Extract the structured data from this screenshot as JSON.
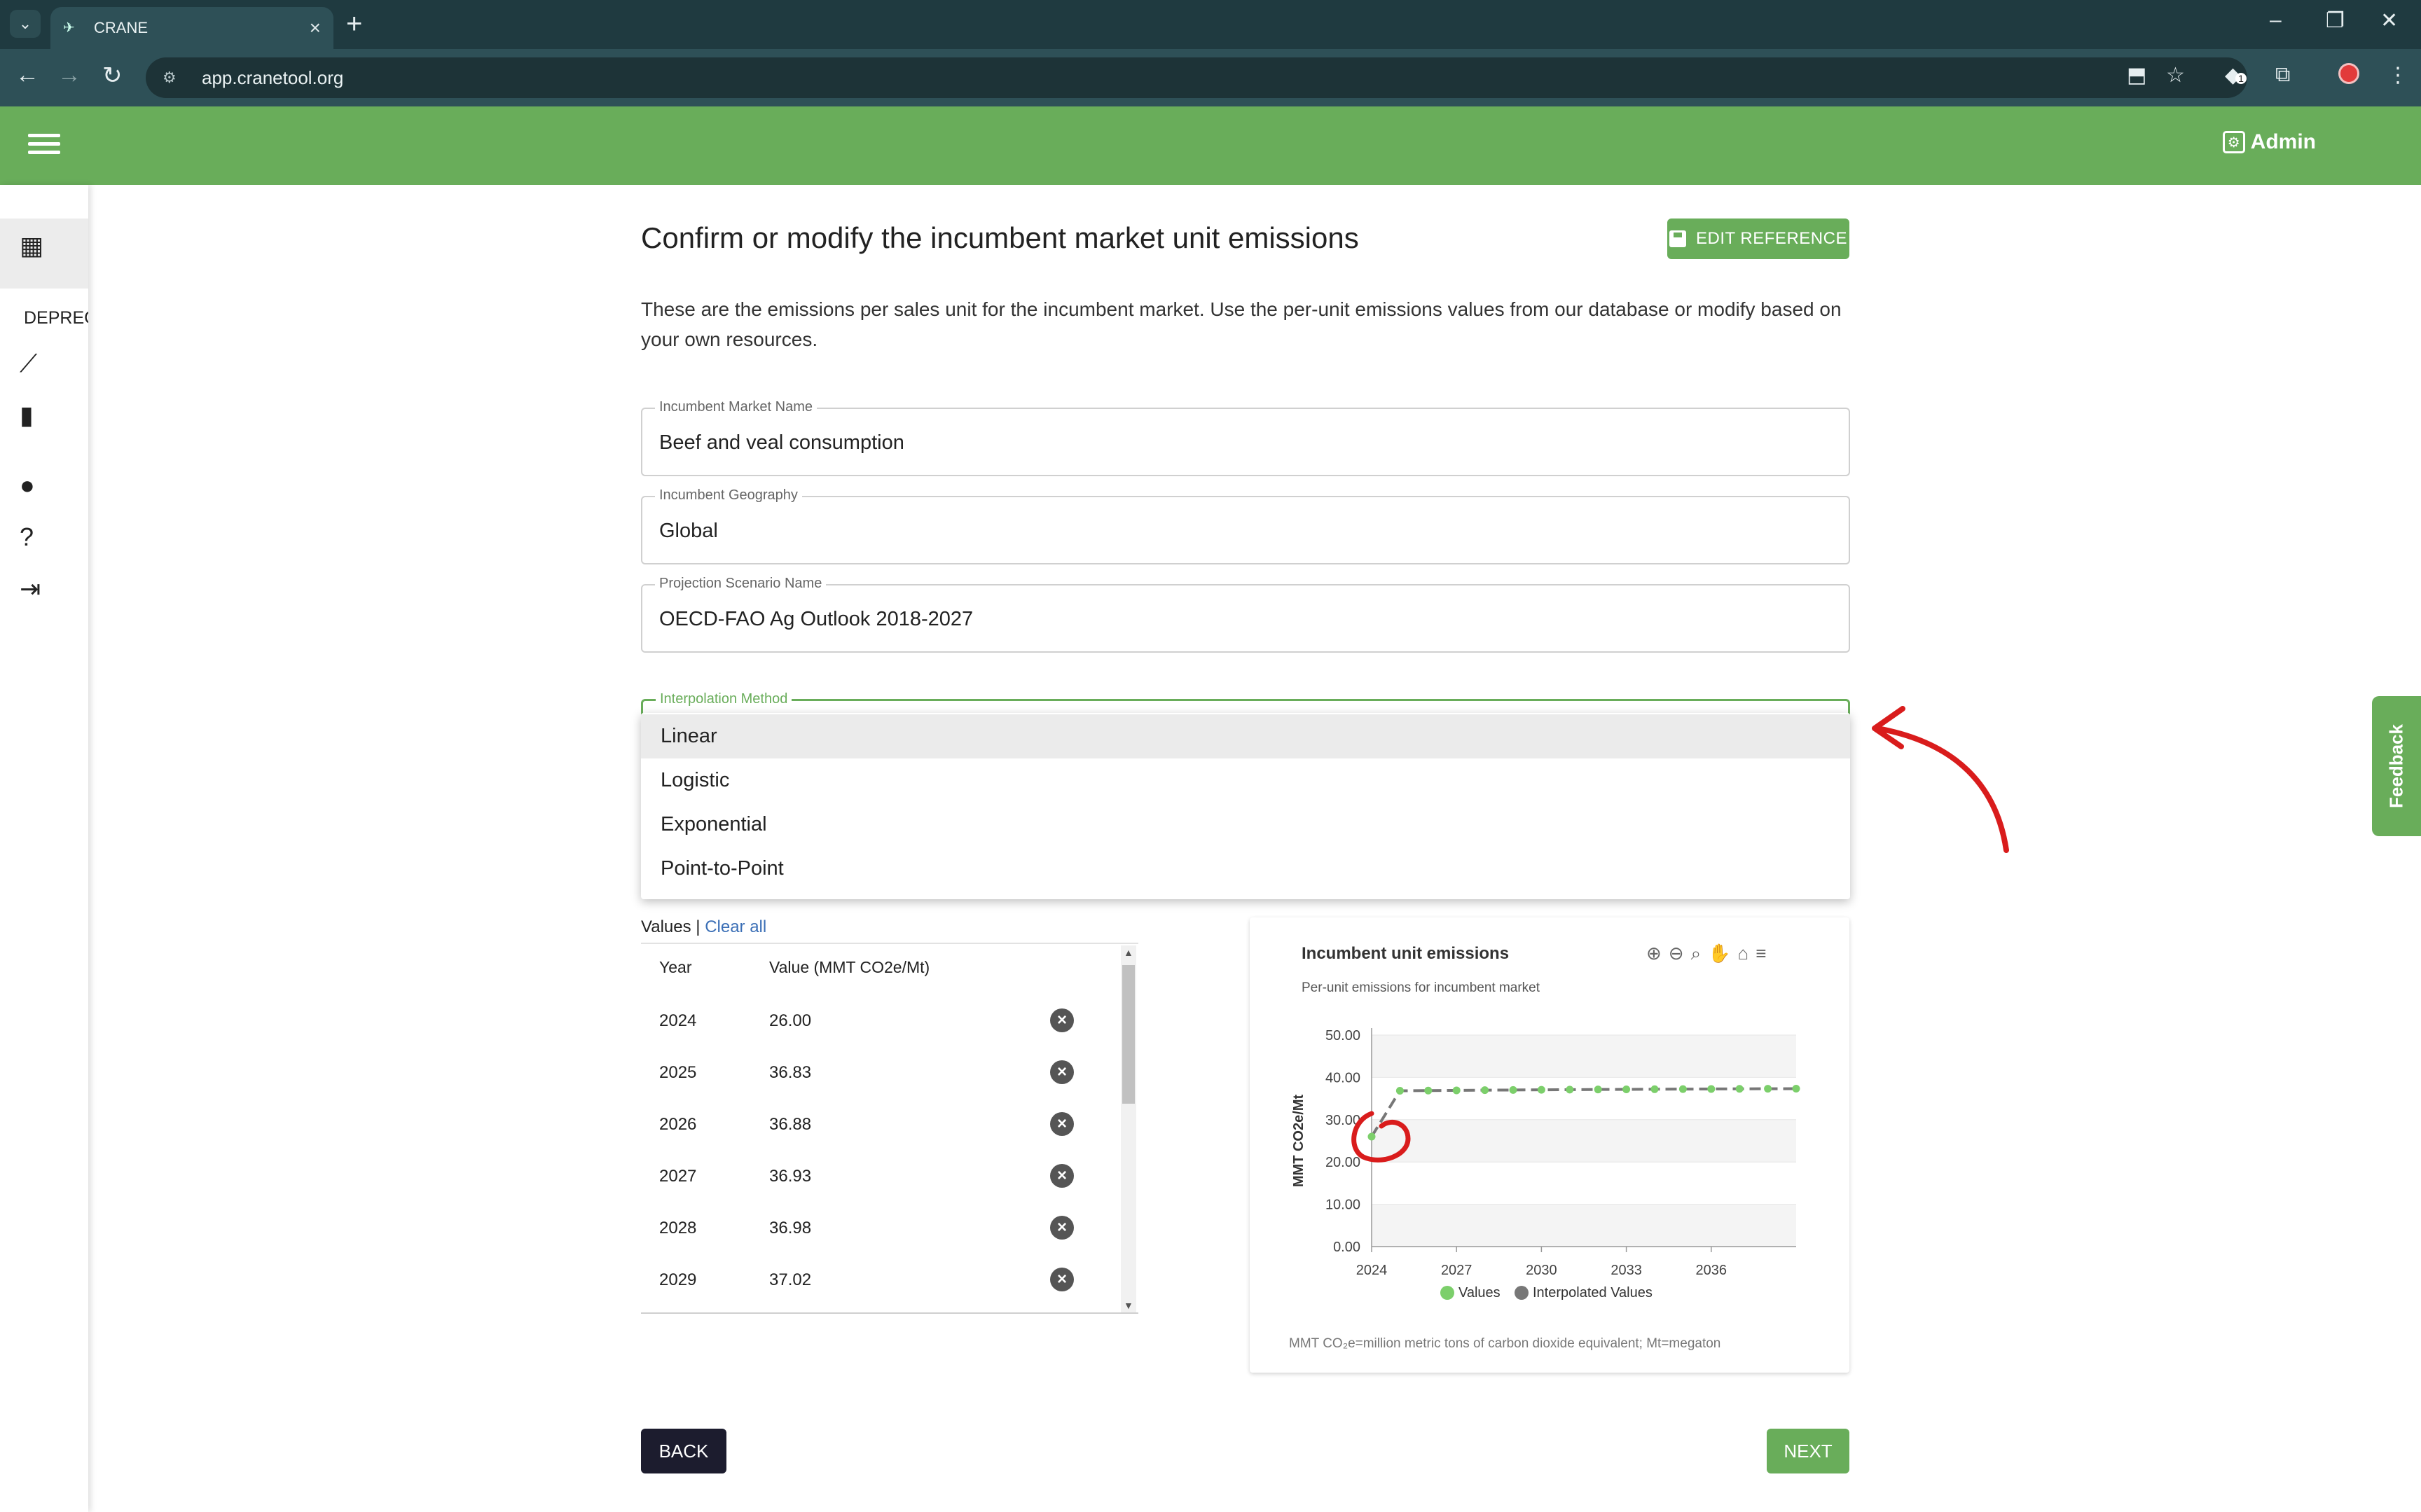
{
  "browser": {
    "tab_title": "CRANE",
    "url": "app.cranetool.org",
    "extension_badge": "1"
  },
  "header": {
    "admin_label": "Admin"
  },
  "sidebar": {
    "section_label": "DEPRECA"
  },
  "page": {
    "title": "Confirm or modify the incumbent market unit emissions",
    "edit_reference_label": "EDIT REFERENCE",
    "description": "These are the emissions per sales unit for the incumbent market. Use the per-unit emissions values from our database or modify based on your own resources."
  },
  "form": {
    "market_name": {
      "label": "Incumbent Market Name",
      "value": "Beef and veal consumption"
    },
    "geography": {
      "label": "Incumbent Geography",
      "value": "Global"
    },
    "scenario": {
      "label": "Projection Scenario Name",
      "value": "OECD-FAO Ag Outlook 2018-2027"
    },
    "interpolation": {
      "label": "Interpolation Method",
      "selected": "Linear",
      "options": [
        "Linear",
        "Logistic",
        "Exponential",
        "Point-to-Point"
      ]
    }
  },
  "values_table": {
    "heading": "Values |",
    "clear_all": "Clear all",
    "col_year": "Year",
    "col_value": "Value (MMT CO2e/Mt)",
    "rows": [
      {
        "year": "2024",
        "value": "26.00"
      },
      {
        "year": "2025",
        "value": "36.83"
      },
      {
        "year": "2026",
        "value": "36.88"
      },
      {
        "year": "2027",
        "value": "36.93"
      },
      {
        "year": "2028",
        "value": "36.98"
      },
      {
        "year": "2029",
        "value": "37.02"
      }
    ]
  },
  "chart": {
    "footnote": "MMT CO₂e=million metric tons of carbon dioxide equivalent; Mt=megaton"
  },
  "chart_data": {
    "type": "line",
    "title": "Incumbent unit emissions",
    "subtitle": "Per-unit emissions for incumbent market",
    "ylabel": "MMT CO2e/Mt",
    "xlabel": "",
    "ylim": [
      0,
      50
    ],
    "xlim": [
      2024,
      2039
    ],
    "y_ticks": [
      "0.00",
      "10.00",
      "20.00",
      "30.00",
      "40.00",
      "50.00"
    ],
    "x_ticks": [
      "2024",
      "2027",
      "2030",
      "2033",
      "2036"
    ],
    "legend_position": "bottom",
    "colors": {
      "values": "#7ccf6b",
      "interpolated": "#777777"
    },
    "x": [
      2024,
      2025,
      2026,
      2027,
      2028,
      2029,
      2030,
      2031,
      2032,
      2033,
      2034,
      2035,
      2036,
      2037,
      2038,
      2039
    ],
    "series": [
      {
        "name": "Values",
        "values": [
          26.0,
          36.83,
          36.88,
          36.93,
          36.98,
          37.02,
          37.06,
          37.1,
          37.14,
          37.17,
          37.2,
          37.23,
          37.26,
          37.29,
          37.31,
          37.33
        ]
      },
      {
        "name": "Interpolated Values",
        "values": [
          26.0,
          36.83,
          36.88,
          36.93,
          36.98,
          37.02,
          37.06,
          37.1,
          37.14,
          37.17,
          37.2,
          37.23,
          37.26,
          37.29,
          37.31,
          37.33
        ]
      }
    ]
  },
  "buttons": {
    "back": "BACK",
    "next": "NEXT",
    "feedback": "Feedback"
  }
}
